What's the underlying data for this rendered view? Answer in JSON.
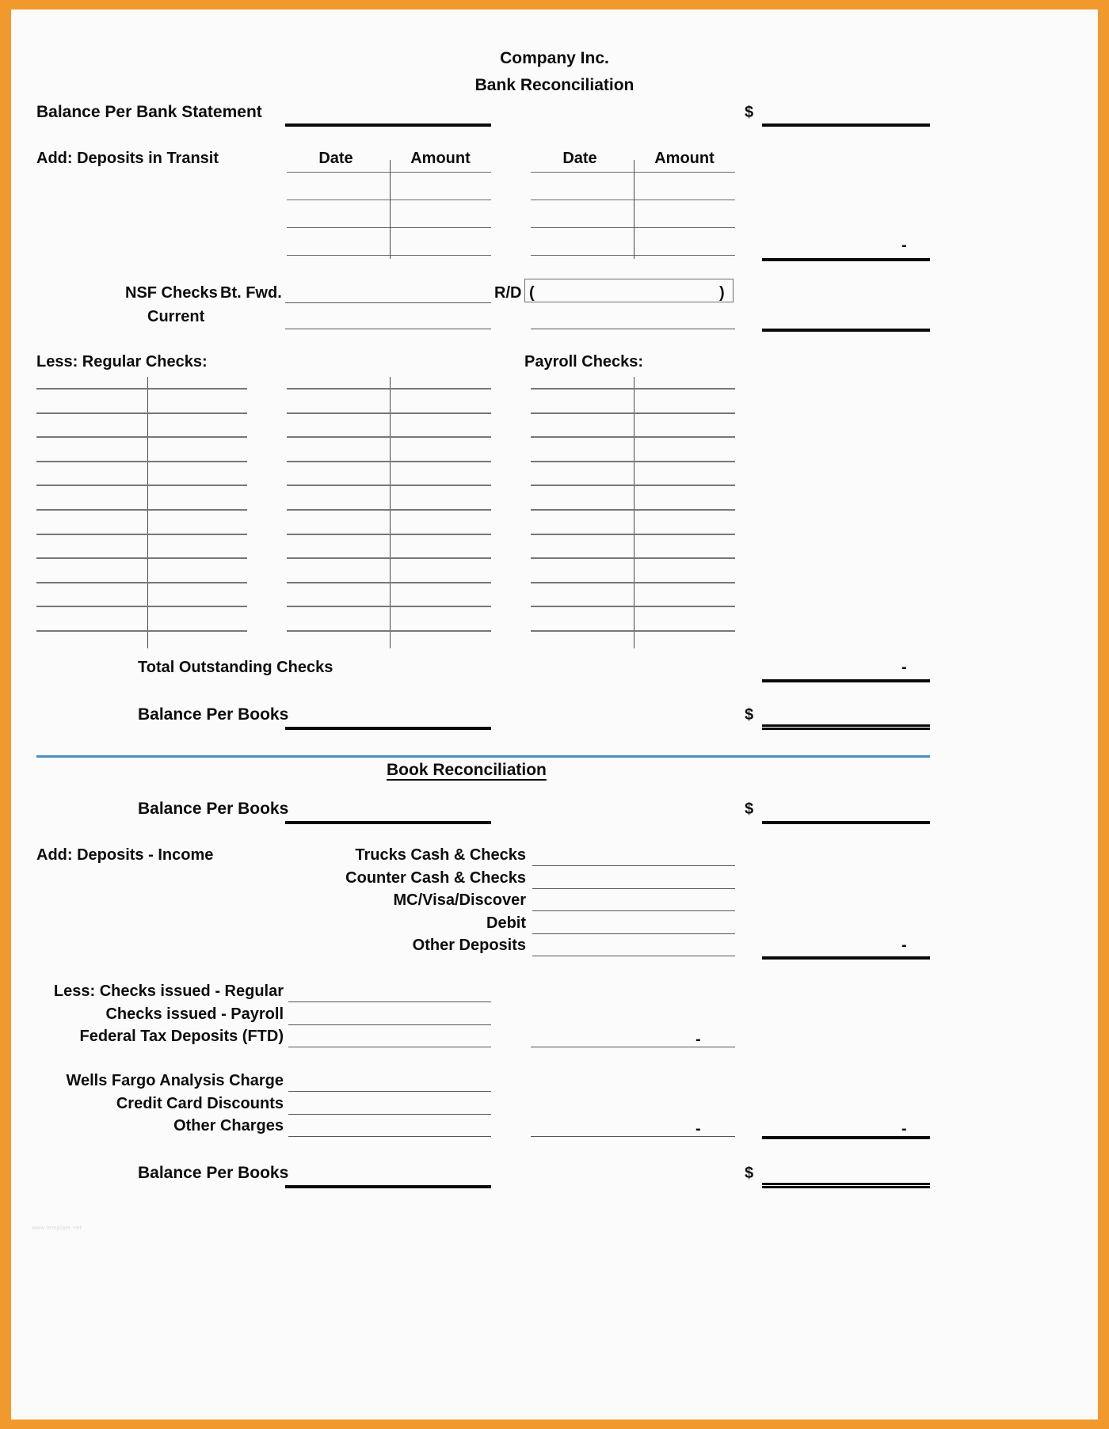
{
  "document": {
    "company": "Company Inc.",
    "title": "Bank Reconciliation",
    "book_section_title": "Book Reconciliation",
    "watermark": "www.template.net"
  },
  "currency_symbol": "$",
  "bank_section": {
    "balance_per_bank_label": "Balance Per Bank Statement",
    "deposits_in_transit_label": "Add:   Deposits in Transit",
    "deposit_table_headers": [
      "Date",
      "Amount",
      "Date",
      "Amount"
    ],
    "deposit_table_rows": 4,
    "nsf_label": "NSF Checks",
    "bt_fwd_label": "Bt. Fwd.",
    "current_label": "Current",
    "rd_label": "R/D",
    "rd_open_paren": "(",
    "rd_close_paren": ")",
    "regular_checks_label": "Less:  Regular Checks:",
    "payroll_checks_label": "Payroll Checks:",
    "check_grid_rows": 11,
    "check_grid_columns": 3,
    "total_outstanding_label": "Total Outstanding Checks",
    "balance_per_books_label": "Balance Per Books",
    "deposit_total_dash": "-",
    "outstanding_total_dash": "-"
  },
  "book_section": {
    "balance_per_books_label": "Balance Per Books",
    "add_deposits_label": "Add:  Deposits - Income",
    "deposit_items": [
      "Trucks Cash & Checks",
      "Counter Cash & Checks",
      "MC/Visa/Discover",
      "Debit",
      "Other Deposits"
    ],
    "deposit_total_dash": "-",
    "less_items": [
      "Less:  Checks issued - Regular",
      "Checks issued - Payroll",
      "Federal Tax Deposits (FTD)"
    ],
    "ftd_dash": "-",
    "charge_items": [
      "Wells Fargo Analysis Charge",
      "Credit Card Discounts",
      "Other Charges"
    ],
    "charges_subtotal_dash": "-",
    "charges_total_dash": "-",
    "final_balance_label": "Balance Per Books"
  },
  "colors": {
    "border": "#f2992e",
    "paper": "#fbfbfb",
    "ink": "#0d0d0d",
    "divider": "#4a8fc0"
  }
}
